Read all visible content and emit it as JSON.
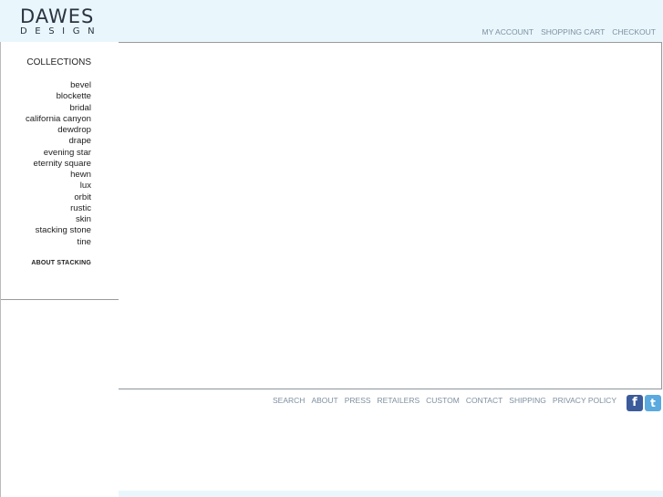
{
  "brand": {
    "name": "DAWES",
    "sub": "DESIGN"
  },
  "top_nav": [
    "MY ACCOUNT",
    "SHOPPING CART",
    "CHECKOUT"
  ],
  "sidebar": {
    "title": "COLLECTIONS",
    "items": [
      "bevel",
      "blockette",
      "bridal",
      "california canyon",
      "dewdrop",
      "drape",
      "evening star",
      "eternity square",
      "hewn",
      "lux",
      "orbit",
      "rustic",
      "skin",
      "stacking stone",
      "tine"
    ],
    "about": "ABOUT STACKING"
  },
  "footer_nav": [
    "SEARCH",
    "ABOUT",
    "PRESS",
    "RETAILERS",
    "CUSTOM",
    "CONTACT",
    "SHIPPING",
    "PRIVACY POLICY"
  ],
  "social": {
    "facebook": "f",
    "twitter": "t"
  },
  "colors": {
    "background": "#e9f7fd",
    "nav_text": "#7e8fa0",
    "facebook": "#3b5b9a",
    "twitter": "#5aa9df"
  }
}
